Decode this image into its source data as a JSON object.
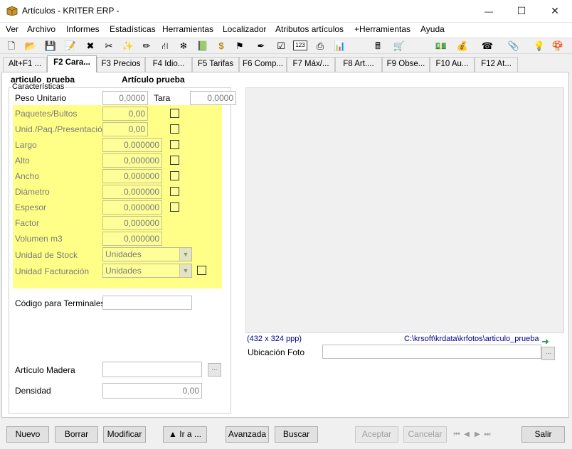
{
  "window": {
    "title": "Artículos - KRITER ERP -",
    "minimize": "—",
    "maximize": "☐",
    "close": "✕"
  },
  "menu": [
    "Ver",
    "Archivo",
    "Informes",
    "Estadísticas",
    "Herramientas",
    "Localizador",
    "Atributos artículos",
    "+Herramientas",
    "Ayuda"
  ],
  "toolbar_icons": [
    {
      "name": "new-doc-icon",
      "glyph": "🗋"
    },
    {
      "name": "open-folder-icon",
      "glyph": "📂"
    },
    {
      "name": "save-icon",
      "glyph": "💾"
    },
    {
      "name": "edit-icon",
      "glyph": "📝"
    },
    {
      "name": "delete-icon",
      "glyph": "✖"
    },
    {
      "name": "tools-icon",
      "glyph": "✂"
    },
    {
      "name": "wizard-icon",
      "glyph": "✨"
    },
    {
      "name": "pencil-icon",
      "glyph": "✏"
    },
    {
      "name": "tree-icon",
      "glyph": "⛙"
    },
    {
      "name": "snowflake-icon",
      "glyph": "❄"
    },
    {
      "name": "book-icon",
      "glyph": "📗"
    },
    {
      "name": "dollar-icon",
      "glyph": "$"
    },
    {
      "name": "stamp-icon",
      "glyph": "⚑"
    },
    {
      "name": "link-icon",
      "glyph": "✒"
    },
    {
      "name": "checklist-icon",
      "glyph": "☑"
    },
    {
      "name": "numbers-icon",
      "glyph": "123"
    },
    {
      "name": "printer-icon",
      "glyph": "⎙"
    },
    {
      "name": "bar-chart-icon",
      "glyph": "📊"
    },
    {
      "name": "calculator-icon",
      "glyph": "🖩"
    },
    {
      "name": "cart-icon",
      "glyph": "🛒"
    },
    {
      "name": "banknote-icon",
      "glyph": "💵"
    },
    {
      "name": "money-bag-icon",
      "glyph": "💰"
    },
    {
      "name": "phone-icon",
      "glyph": "☎"
    },
    {
      "name": "paperclip-icon",
      "glyph": "📎"
    },
    {
      "name": "lightbulb-icon",
      "glyph": "💡"
    },
    {
      "name": "mushroom-icon",
      "glyph": "🍄"
    }
  ],
  "tabs": [
    "Alt+F1 ...",
    "F2 Cara...",
    "F3 Precios",
    "F4 Idio...",
    "F5 Tarifas",
    "F6 Comp...",
    "F7 Máx/...",
    "F8 Art....",
    "F9 Obse...",
    "F10 Au...",
    "F12 At..."
  ],
  "article": {
    "code": "articulo_prueba",
    "name": "Artículo prueba"
  },
  "group_caption": "Características",
  "fields": {
    "peso_unitario": {
      "label": "Peso Unitario",
      "value": "0,0000"
    },
    "tara": {
      "label": "Tara",
      "value": "0,0000"
    },
    "paquetes_bultos": {
      "label": "Paquetes/Bultos",
      "value": "0,00"
    },
    "unid_paq_presentacion": {
      "label": "Unid./Paq./Presentación",
      "value": "0,00"
    },
    "largo": {
      "label": "Largo",
      "value": "0,000000"
    },
    "alto": {
      "label": "Alto",
      "value": "0,000000"
    },
    "ancho": {
      "label": "Ancho",
      "value": "0,000000"
    },
    "diametro": {
      "label": "Diámetro",
      "value": "0,000000"
    },
    "espesor": {
      "label": "Espesor",
      "value": "0,000000"
    },
    "factor": {
      "label": "Factor",
      "value": "0,000000"
    },
    "volumen_m3": {
      "label": "Volumen m3",
      "value": "0,000000"
    },
    "unidad_stock": {
      "label": "Unidad de Stock",
      "value": "Unidades"
    },
    "unidad_facturacion": {
      "label": "Unidad Facturación",
      "value": "Unidades"
    },
    "codigo_terminales": {
      "label": "Código para Terminales",
      "value": ""
    },
    "articulo_madera": {
      "label": "Artículo Madera",
      "value": ""
    },
    "densidad": {
      "label": "Densidad",
      "value": "0,00"
    }
  },
  "photo": {
    "size_text": "(432 x 324 ppp)",
    "path": "C:\\krsoft\\krdata\\krfotos\\articulo_prueba",
    "location_label": "Ubicación Foto",
    "location_value": "",
    "browse": "...",
    "go_arrow": "➜"
  },
  "ellipsis": "...",
  "buttons": {
    "nuevo": "Nuevo",
    "borrar": "Borrar",
    "modificar": "Modificar",
    "ir_a": "▲ Ir a ...",
    "avanzada": "Avanzada",
    "buscar": "Buscar",
    "aceptar": "Aceptar",
    "cancelar": "Cancelar",
    "salir": "Salir"
  },
  "nav": {
    "first": "⏮",
    "prev": "◀",
    "next": "▶",
    "last": "⏭"
  },
  "colors": {
    "highlight": "#ffff88",
    "link": "#00008b"
  }
}
